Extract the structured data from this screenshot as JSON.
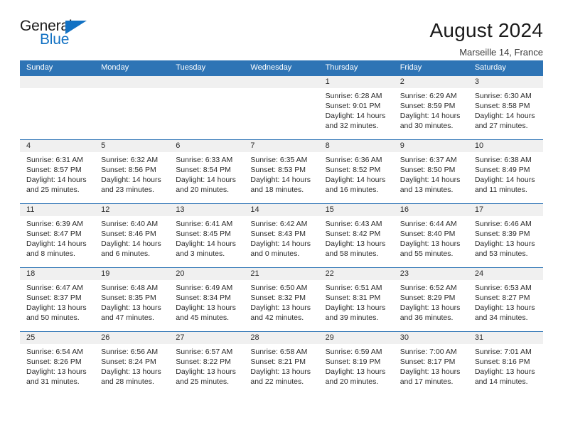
{
  "brand": {
    "name_top": "General",
    "name_bottom": "Blue",
    "flag_icon": "triangle-flag-icon",
    "color": "#1271c3"
  },
  "header": {
    "title": "August 2024",
    "location": "Marseille 14, France"
  },
  "theme": {
    "header_blue": "#2e74b5",
    "daynum_band": "#f0f0f0"
  },
  "calendar": {
    "weekdays": [
      "Sunday",
      "Monday",
      "Tuesday",
      "Wednesday",
      "Thursday",
      "Friday",
      "Saturday"
    ],
    "weeks": [
      {
        "days": [
          {
            "num": "",
            "sunrise": "",
            "sunset": "",
            "daylight": "",
            "empty": true
          },
          {
            "num": "",
            "sunrise": "",
            "sunset": "",
            "daylight": "",
            "empty": true
          },
          {
            "num": "",
            "sunrise": "",
            "sunset": "",
            "daylight": "",
            "empty": true
          },
          {
            "num": "",
            "sunrise": "",
            "sunset": "",
            "daylight": "",
            "empty": true
          },
          {
            "num": "1",
            "sunrise": "Sunrise: 6:28 AM",
            "sunset": "Sunset: 9:01 PM",
            "daylight": "Daylight: 14 hours and 32 minutes.",
            "empty": false
          },
          {
            "num": "2",
            "sunrise": "Sunrise: 6:29 AM",
            "sunset": "Sunset: 8:59 PM",
            "daylight": "Daylight: 14 hours and 30 minutes.",
            "empty": false
          },
          {
            "num": "3",
            "sunrise": "Sunrise: 6:30 AM",
            "sunset": "Sunset: 8:58 PM",
            "daylight": "Daylight: 14 hours and 27 minutes.",
            "empty": false
          }
        ]
      },
      {
        "days": [
          {
            "num": "4",
            "sunrise": "Sunrise: 6:31 AM",
            "sunset": "Sunset: 8:57 PM",
            "daylight": "Daylight: 14 hours and 25 minutes.",
            "empty": false
          },
          {
            "num": "5",
            "sunrise": "Sunrise: 6:32 AM",
            "sunset": "Sunset: 8:56 PM",
            "daylight": "Daylight: 14 hours and 23 minutes.",
            "empty": false
          },
          {
            "num": "6",
            "sunrise": "Sunrise: 6:33 AM",
            "sunset": "Sunset: 8:54 PM",
            "daylight": "Daylight: 14 hours and 20 minutes.",
            "empty": false
          },
          {
            "num": "7",
            "sunrise": "Sunrise: 6:35 AM",
            "sunset": "Sunset: 8:53 PM",
            "daylight": "Daylight: 14 hours and 18 minutes.",
            "empty": false
          },
          {
            "num": "8",
            "sunrise": "Sunrise: 6:36 AM",
            "sunset": "Sunset: 8:52 PM",
            "daylight": "Daylight: 14 hours and 16 minutes.",
            "empty": false
          },
          {
            "num": "9",
            "sunrise": "Sunrise: 6:37 AM",
            "sunset": "Sunset: 8:50 PM",
            "daylight": "Daylight: 14 hours and 13 minutes.",
            "empty": false
          },
          {
            "num": "10",
            "sunrise": "Sunrise: 6:38 AM",
            "sunset": "Sunset: 8:49 PM",
            "daylight": "Daylight: 14 hours and 11 minutes.",
            "empty": false
          }
        ]
      },
      {
        "days": [
          {
            "num": "11",
            "sunrise": "Sunrise: 6:39 AM",
            "sunset": "Sunset: 8:47 PM",
            "daylight": "Daylight: 14 hours and 8 minutes.",
            "empty": false
          },
          {
            "num": "12",
            "sunrise": "Sunrise: 6:40 AM",
            "sunset": "Sunset: 8:46 PM",
            "daylight": "Daylight: 14 hours and 6 minutes.",
            "empty": false
          },
          {
            "num": "13",
            "sunrise": "Sunrise: 6:41 AM",
            "sunset": "Sunset: 8:45 PM",
            "daylight": "Daylight: 14 hours and 3 minutes.",
            "empty": false
          },
          {
            "num": "14",
            "sunrise": "Sunrise: 6:42 AM",
            "sunset": "Sunset: 8:43 PM",
            "daylight": "Daylight: 14 hours and 0 minutes.",
            "empty": false
          },
          {
            "num": "15",
            "sunrise": "Sunrise: 6:43 AM",
            "sunset": "Sunset: 8:42 PM",
            "daylight": "Daylight: 13 hours and 58 minutes.",
            "empty": false
          },
          {
            "num": "16",
            "sunrise": "Sunrise: 6:44 AM",
            "sunset": "Sunset: 8:40 PM",
            "daylight": "Daylight: 13 hours and 55 minutes.",
            "empty": false
          },
          {
            "num": "17",
            "sunrise": "Sunrise: 6:46 AM",
            "sunset": "Sunset: 8:39 PM",
            "daylight": "Daylight: 13 hours and 53 minutes.",
            "empty": false
          }
        ]
      },
      {
        "days": [
          {
            "num": "18",
            "sunrise": "Sunrise: 6:47 AM",
            "sunset": "Sunset: 8:37 PM",
            "daylight": "Daylight: 13 hours and 50 minutes.",
            "empty": false
          },
          {
            "num": "19",
            "sunrise": "Sunrise: 6:48 AM",
            "sunset": "Sunset: 8:35 PM",
            "daylight": "Daylight: 13 hours and 47 minutes.",
            "empty": false
          },
          {
            "num": "20",
            "sunrise": "Sunrise: 6:49 AM",
            "sunset": "Sunset: 8:34 PM",
            "daylight": "Daylight: 13 hours and 45 minutes.",
            "empty": false
          },
          {
            "num": "21",
            "sunrise": "Sunrise: 6:50 AM",
            "sunset": "Sunset: 8:32 PM",
            "daylight": "Daylight: 13 hours and 42 minutes.",
            "empty": false
          },
          {
            "num": "22",
            "sunrise": "Sunrise: 6:51 AM",
            "sunset": "Sunset: 8:31 PM",
            "daylight": "Daylight: 13 hours and 39 minutes.",
            "empty": false
          },
          {
            "num": "23",
            "sunrise": "Sunrise: 6:52 AM",
            "sunset": "Sunset: 8:29 PM",
            "daylight": "Daylight: 13 hours and 36 minutes.",
            "empty": false
          },
          {
            "num": "24",
            "sunrise": "Sunrise: 6:53 AM",
            "sunset": "Sunset: 8:27 PM",
            "daylight": "Daylight: 13 hours and 34 minutes.",
            "empty": false
          }
        ]
      },
      {
        "days": [
          {
            "num": "25",
            "sunrise": "Sunrise: 6:54 AM",
            "sunset": "Sunset: 8:26 PM",
            "daylight": "Daylight: 13 hours and 31 minutes.",
            "empty": false
          },
          {
            "num": "26",
            "sunrise": "Sunrise: 6:56 AM",
            "sunset": "Sunset: 8:24 PM",
            "daylight": "Daylight: 13 hours and 28 minutes.",
            "empty": false
          },
          {
            "num": "27",
            "sunrise": "Sunrise: 6:57 AM",
            "sunset": "Sunset: 8:22 PM",
            "daylight": "Daylight: 13 hours and 25 minutes.",
            "empty": false
          },
          {
            "num": "28",
            "sunrise": "Sunrise: 6:58 AM",
            "sunset": "Sunset: 8:21 PM",
            "daylight": "Daylight: 13 hours and 22 minutes.",
            "empty": false
          },
          {
            "num": "29",
            "sunrise": "Sunrise: 6:59 AM",
            "sunset": "Sunset: 8:19 PM",
            "daylight": "Daylight: 13 hours and 20 minutes.",
            "empty": false
          },
          {
            "num": "30",
            "sunrise": "Sunrise: 7:00 AM",
            "sunset": "Sunset: 8:17 PM",
            "daylight": "Daylight: 13 hours and 17 minutes.",
            "empty": false
          },
          {
            "num": "31",
            "sunrise": "Sunrise: 7:01 AM",
            "sunset": "Sunset: 8:16 PM",
            "daylight": "Daylight: 13 hours and 14 minutes.",
            "empty": false
          }
        ]
      }
    ]
  }
}
